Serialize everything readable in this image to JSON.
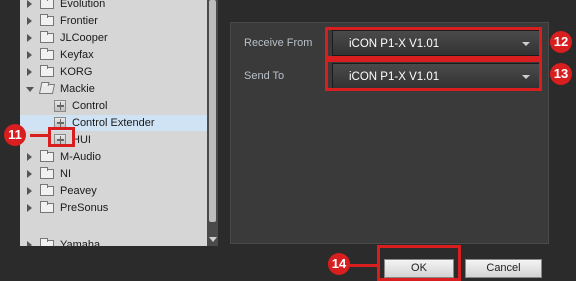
{
  "tree": {
    "items": [
      {
        "label": "Evolution",
        "kind": "folder",
        "expanded": false
      },
      {
        "label": "Frontier",
        "kind": "folder",
        "expanded": false
      },
      {
        "label": "JLCooper",
        "kind": "folder",
        "expanded": false
      },
      {
        "label": "Keyfax",
        "kind": "folder",
        "expanded": false
      },
      {
        "label": "KORG",
        "kind": "folder",
        "expanded": false
      },
      {
        "label": "Mackie",
        "kind": "folder",
        "expanded": true
      },
      {
        "label": "Control",
        "kind": "device"
      },
      {
        "label": "Control Extender",
        "kind": "device",
        "selected": true
      },
      {
        "label": "HUI",
        "kind": "device"
      },
      {
        "label": "M-Audio",
        "kind": "folder",
        "expanded": false
      },
      {
        "label": "NI",
        "kind": "folder",
        "expanded": false
      },
      {
        "label": "Peavey",
        "kind": "folder",
        "expanded": false
      },
      {
        "label": "PreSonus",
        "kind": "folder",
        "expanded": false
      },
      {
        "label": "Yamaha",
        "kind": "folder",
        "expanded": false
      }
    ]
  },
  "settings": {
    "receive_from_label": "Receive From",
    "receive_from_value": "iCON P1-X V1.01",
    "send_to_label": "Send To",
    "send_to_value": "iCON P1-X V1.01"
  },
  "buttons": {
    "ok": "OK",
    "cancel": "Cancel"
  },
  "callouts": {
    "c11": "11",
    "c12": "12",
    "c13": "13",
    "c14": "14"
  },
  "colors": {
    "callout": "#d81e1e",
    "selection": "#cfe3f5"
  }
}
